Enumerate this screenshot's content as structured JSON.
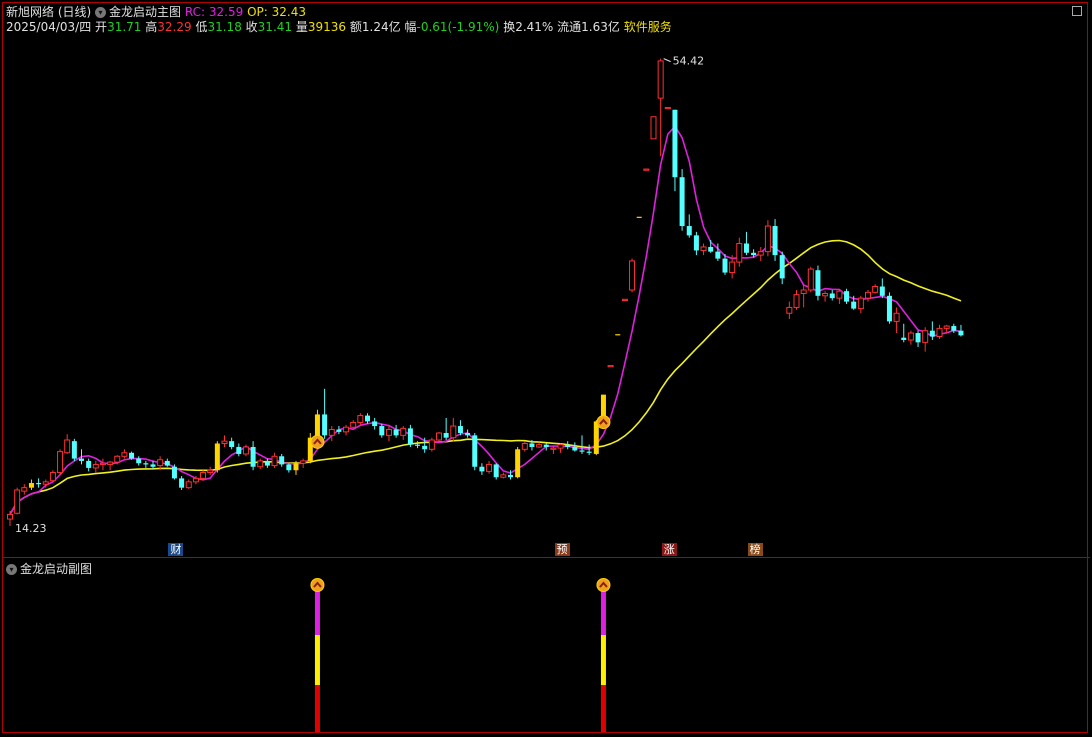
{
  "header": {
    "stock_name": "新旭网络",
    "period": "(日线)",
    "indicator_name": "金龙启动主图",
    "rc_label": "RC:",
    "rc_value": "32.59",
    "op_label": "OP:",
    "op_value": "32.43"
  },
  "quote": {
    "date": "2025/04/03/四",
    "open_label": "开",
    "open": "31.71",
    "high_label": "高",
    "high": "32.29",
    "low_label": "低",
    "low": "31.18",
    "close_label": "收",
    "close": "31.41",
    "volume_label": "量",
    "volume": "39136",
    "amount_label": "额",
    "amount": "1.24亿",
    "change_label": "幅",
    "change": "-0.61(-1.91%)",
    "turnover_label": "换",
    "turnover": "2.41%",
    "float_label": "流通",
    "float": "1.63亿",
    "service": "软件服务"
  },
  "price_marks": {
    "max": "54.42",
    "min": "14.23"
  },
  "events": [
    "财",
    "预",
    "涨",
    "榜"
  ],
  "sub_panel": {
    "title": "金龙启动副图"
  },
  "colors": {
    "up": "#ff3030",
    "down": "#54ffff",
    "signal": "#ffd400",
    "ma_short": "#e020e0",
    "ma_long": "#f0f020"
  },
  "chart_data": {
    "type": "candlestick",
    "candles": [
      [
        14.8,
        15.5,
        14.2,
        15.2
      ],
      [
        15.3,
        17.5,
        15.2,
        17.3
      ],
      [
        17.2,
        17.8,
        16.9,
        17.5
      ],
      [
        17.5,
        18.2,
        17.3,
        17.9
      ],
      [
        17.9,
        18.3,
        17.5,
        17.8
      ],
      [
        17.8,
        18.2,
        17.5,
        18.0
      ],
      [
        18.1,
        19.0,
        18.0,
        18.8
      ],
      [
        18.8,
        20.8,
        18.6,
        20.6
      ],
      [
        20.5,
        22.1,
        20.4,
        21.6
      ],
      [
        21.5,
        21.7,
        19.8,
        20.0
      ],
      [
        20.0,
        20.8,
        19.5,
        19.8
      ],
      [
        19.8,
        20.0,
        18.9,
        19.2
      ],
      [
        19.2,
        19.8,
        18.8,
        19.5
      ],
      [
        19.5,
        20.0,
        19.0,
        19.6
      ],
      [
        19.5,
        19.8,
        19.0,
        19.7
      ],
      [
        19.7,
        20.3,
        19.5,
        20.2
      ],
      [
        20.2,
        20.8,
        20.0,
        20.5
      ],
      [
        20.5,
        20.6,
        19.9,
        20.0
      ],
      [
        20.0,
        20.2,
        19.4,
        19.6
      ],
      [
        19.6,
        19.8,
        19.2,
        19.5
      ],
      [
        19.5,
        19.8,
        19.1,
        19.3
      ],
      [
        19.4,
        20.2,
        19.0,
        19.9
      ],
      [
        19.8,
        20.0,
        19.3,
        19.4
      ],
      [
        19.3,
        19.5,
        18.2,
        18.3
      ],
      [
        18.3,
        18.5,
        17.3,
        17.5
      ],
      [
        17.5,
        18.2,
        17.4,
        18.0
      ],
      [
        18.0,
        18.5,
        17.8,
        18.3
      ],
      [
        18.3,
        19.0,
        18.1,
        18.8
      ],
      [
        18.8,
        19.3,
        18.6,
        19.0
      ],
      [
        19.0,
        21.5,
        18.8,
        21.3
      ],
      [
        21.3,
        22.0,
        21.0,
        21.5
      ],
      [
        21.5,
        21.8,
        20.8,
        21.0
      ],
      [
        21.0,
        21.3,
        20.2,
        20.4
      ],
      [
        20.4,
        21.2,
        20.2,
        21.0
      ],
      [
        21.0,
        21.5,
        19.0,
        19.3
      ],
      [
        19.3,
        20.0,
        19.1,
        19.8
      ],
      [
        19.8,
        20.0,
        19.2,
        19.4
      ],
      [
        19.4,
        20.5,
        19.2,
        20.2
      ],
      [
        20.2,
        20.4,
        19.3,
        19.5
      ],
      [
        19.5,
        19.6,
        18.8,
        19.0
      ],
      [
        19.0,
        19.8,
        18.6,
        19.6
      ],
      [
        19.6,
        20.0,
        19.2,
        19.8
      ],
      [
        19.8,
        22.2,
        19.6,
        21.8
      ],
      [
        21.8,
        24.2,
        21.6,
        23.8
      ],
      [
        23.8,
        26.0,
        21.7,
        22.0
      ],
      [
        22.0,
        22.8,
        21.5,
        22.5
      ],
      [
        22.5,
        22.8,
        22.1,
        22.3
      ],
      [
        22.3,
        22.9,
        22.0,
        22.7
      ],
      [
        22.7,
        23.3,
        22.5,
        23.1
      ],
      [
        23.1,
        23.9,
        22.9,
        23.7
      ],
      [
        23.7,
        23.9,
        23.0,
        23.2
      ],
      [
        23.2,
        23.5,
        22.5,
        22.8
      ],
      [
        22.8,
        23.0,
        21.8,
        22.0
      ],
      [
        22.0,
        22.8,
        21.5,
        22.5
      ],
      [
        22.5,
        22.9,
        21.8,
        22.0
      ],
      [
        22.0,
        22.8,
        21.6,
        22.6
      ],
      [
        22.6,
        22.9,
        21.0,
        21.2
      ],
      [
        21.2,
        21.5,
        20.9,
        21.1
      ],
      [
        21.1,
        21.8,
        20.5,
        20.8
      ],
      [
        20.8,
        21.8,
        20.6,
        21.6
      ],
      [
        21.6,
        22.3,
        21.4,
        22.2
      ],
      [
        22.2,
        23.5,
        21.6,
        21.8
      ],
      [
        21.8,
        23.5,
        21.5,
        22.8
      ],
      [
        22.8,
        23.3,
        22.0,
        22.2
      ],
      [
        22.2,
        22.5,
        21.8,
        22.0
      ],
      [
        22.0,
        22.2,
        19.0,
        19.3
      ],
      [
        19.3,
        19.6,
        18.6,
        18.9
      ],
      [
        18.9,
        19.8,
        18.7,
        19.5
      ],
      [
        19.5,
        19.6,
        18.2,
        18.4
      ],
      [
        18.4,
        18.8,
        18.3,
        18.6
      ],
      [
        18.6,
        19.0,
        18.2,
        18.4
      ],
      [
        18.4,
        21.0,
        18.3,
        20.8
      ],
      [
        20.8,
        21.5,
        20.6,
        21.3
      ],
      [
        21.3,
        21.6,
        20.7,
        21.0
      ],
      [
        21.0,
        21.4,
        20.9,
        21.2
      ],
      [
        21.2,
        21.3,
        20.7,
        21.0
      ],
      [
        20.8,
        21.1,
        20.4,
        20.9
      ],
      [
        20.9,
        21.3,
        20.5,
        21.2
      ],
      [
        21.2,
        21.5,
        20.8,
        21.0
      ],
      [
        21.0,
        21.4,
        20.6,
        20.7
      ],
      [
        20.7,
        22.0,
        20.4,
        20.6
      ],
      [
        20.6,
        21.2,
        20.3,
        20.5
      ],
      [
        20.4,
        23.3,
        20.3,
        23.2
      ],
      [
        23.3,
        25.5,
        23.3,
        25.5
      ],
      [
        28.0,
        28.0,
        28.0,
        28.0
      ],
      [
        30.7,
        30.7,
        30.7,
        30.7
      ],
      [
        33.7,
        33.7,
        33.7,
        33.7
      ],
      [
        34.5,
        37.2,
        34.3,
        37.0
      ],
      [
        40.8,
        40.8,
        40.8,
        40.8
      ],
      [
        44.9,
        44.9,
        44.9,
        44.9
      ],
      [
        47.5,
        49.4,
        47.5,
        49.4
      ],
      [
        51.0,
        54.4,
        46.0,
        54.2
      ],
      [
        50.2,
        50.2,
        50.2,
        50.2
      ],
      [
        50.0,
        50.0,
        43.0,
        44.2
      ],
      [
        44.2,
        44.9,
        39.6,
        40.0
      ],
      [
        40.0,
        41.0,
        39.0,
        39.2
      ],
      [
        39.2,
        39.5,
        37.5,
        37.9
      ],
      [
        37.9,
        38.5,
        37.5,
        38.2
      ],
      [
        38.2,
        38.8,
        37.7,
        37.8
      ],
      [
        37.8,
        38.5,
        37.0,
        37.2
      ],
      [
        37.2,
        37.6,
        35.8,
        36.0
      ],
      [
        36.0,
        37.5,
        35.5,
        36.9
      ],
      [
        36.9,
        39.0,
        36.5,
        38.5
      ],
      [
        38.5,
        39.5,
        37.5,
        37.7
      ],
      [
        37.7,
        38.0,
        37.3,
        37.5
      ],
      [
        37.5,
        38.2,
        37.0,
        37.8
      ],
      [
        37.8,
        40.5,
        37.4,
        40.0
      ],
      [
        40.0,
        40.6,
        37.0,
        37.5
      ],
      [
        37.5,
        37.8,
        35.0,
        35.5
      ],
      [
        32.5,
        33.5,
        32.0,
        33.0
      ],
      [
        33.0,
        34.5,
        32.8,
        34.1
      ],
      [
        34.2,
        35.0,
        33.0,
        34.5
      ],
      [
        34.5,
        36.5,
        34.3,
        36.3
      ],
      [
        36.2,
        36.6,
        33.6,
        34.0
      ],
      [
        34.0,
        34.4,
        33.5,
        34.2
      ],
      [
        34.2,
        34.5,
        33.6,
        33.8
      ],
      [
        33.8,
        34.6,
        33.3,
        34.4
      ],
      [
        34.4,
        34.6,
        33.3,
        33.5
      ],
      [
        33.5,
        34.0,
        32.8,
        32.9
      ],
      [
        32.9,
        34.0,
        32.5,
        33.8
      ],
      [
        33.8,
        34.5,
        33.5,
        34.3
      ],
      [
        34.3,
        35.0,
        34.2,
        34.8
      ],
      [
        34.8,
        35.5,
        33.8,
        34.0
      ],
      [
        34.0,
        34.3,
        31.6,
        31.8
      ],
      [
        31.8,
        33.0,
        30.8,
        32.5
      ],
      [
        30.4,
        31.6,
        30.0,
        30.2
      ],
      [
        30.2,
        31.0,
        29.8,
        30.8
      ],
      [
        30.8,
        31.0,
        29.6,
        30.0
      ],
      [
        30.0,
        31.3,
        29.2,
        31.0
      ],
      [
        31.0,
        31.8,
        30.2,
        30.5
      ],
      [
        30.5,
        31.5,
        30.3,
        31.2
      ],
      [
        31.2,
        31.5,
        30.8,
        31.4
      ],
      [
        31.4,
        31.6,
        30.8,
        31.0
      ],
      [
        31.0,
        31.5,
        30.5,
        30.6
      ]
    ],
    "ma_short_window": 5,
    "ma_long_window": 30,
    "signal_bars": [
      3,
      29,
      40,
      42,
      43,
      71,
      82,
      83,
      85,
      88
    ],
    "launch_markers": [
      43,
      83
    ],
    "events_at": [
      23,
      77,
      92,
      104
    ],
    "y_range": [
      13.0,
      56.0
    ],
    "sub_bar_segments": [
      "#e020e0",
      "#ffee00",
      "#e00000"
    ]
  }
}
